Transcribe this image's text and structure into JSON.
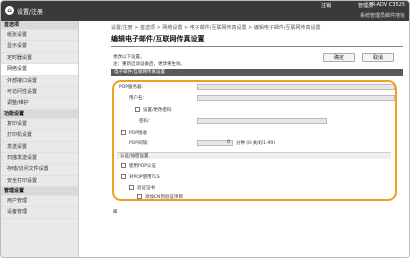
{
  "header": {
    "home_glyph": "⌂",
    "title": "设置/注册",
    "logout": "注销",
    "admin": "管理员",
    "device": "iR-ADV C3525",
    "email": "系统管理员邮件地址"
  },
  "sidebar": {
    "items": [
      {
        "label": "首选项",
        "group": true
      },
      {
        "label": "纸张设置"
      },
      {
        "label": "显示设置"
      },
      {
        "label": "定时器设置"
      },
      {
        "label": "网络设置",
        "active": true
      },
      {
        "label": "外部接口设置"
      },
      {
        "label": "可访问性设置"
      },
      {
        "label": "调整/维护"
      },
      {
        "label": "功能设置",
        "group": true
      },
      {
        "label": "复印设置"
      },
      {
        "label": "打印机设置"
      },
      {
        "label": "发送设置"
      },
      {
        "label": "扫描发送设置"
      },
      {
        "label": "存储/访问文件设置"
      },
      {
        "label": "安全打印设置"
      },
      {
        "label": "管理设置",
        "group": true
      },
      {
        "label": "用户管理"
      },
      {
        "label": "设备管理"
      }
    ]
  },
  "main": {
    "breadcrumb": "设置/注册 > 首选项 > 网络设置 > 电子邮件/互联网传真设置 > 编辑电子邮件/互联网传真设置",
    "title": "编辑电子邮件/互联网传真设置",
    "hint1": "更改以下设置。",
    "hint2": "注：重新启动设备后，更改将生效。",
    "ok_label": "确定",
    "cancel_label": "取消",
    "section_title": "电子邮件/互联网传真设置",
    "pop3_server_label": "POP服务器：",
    "username_label": "用户名：",
    "set_password_label": "设置/更改密码",
    "password_label": "密码：",
    "pop_receive_label": "POP接收",
    "pop_interval_label": "POP间隔：",
    "pop_interval_value": "0",
    "pop_interval_unit": "分钟 (0:关闭/1-99)",
    "auth_section": "认证/加密设置",
    "use_pop_auth_label": "使用POP认证",
    "use_tls_label": "对POP使用TLS",
    "verify_cert_label": "验证证书",
    "add_cn_label": "添加CN到验证项目",
    "bottom_mark": "⊠"
  }
}
